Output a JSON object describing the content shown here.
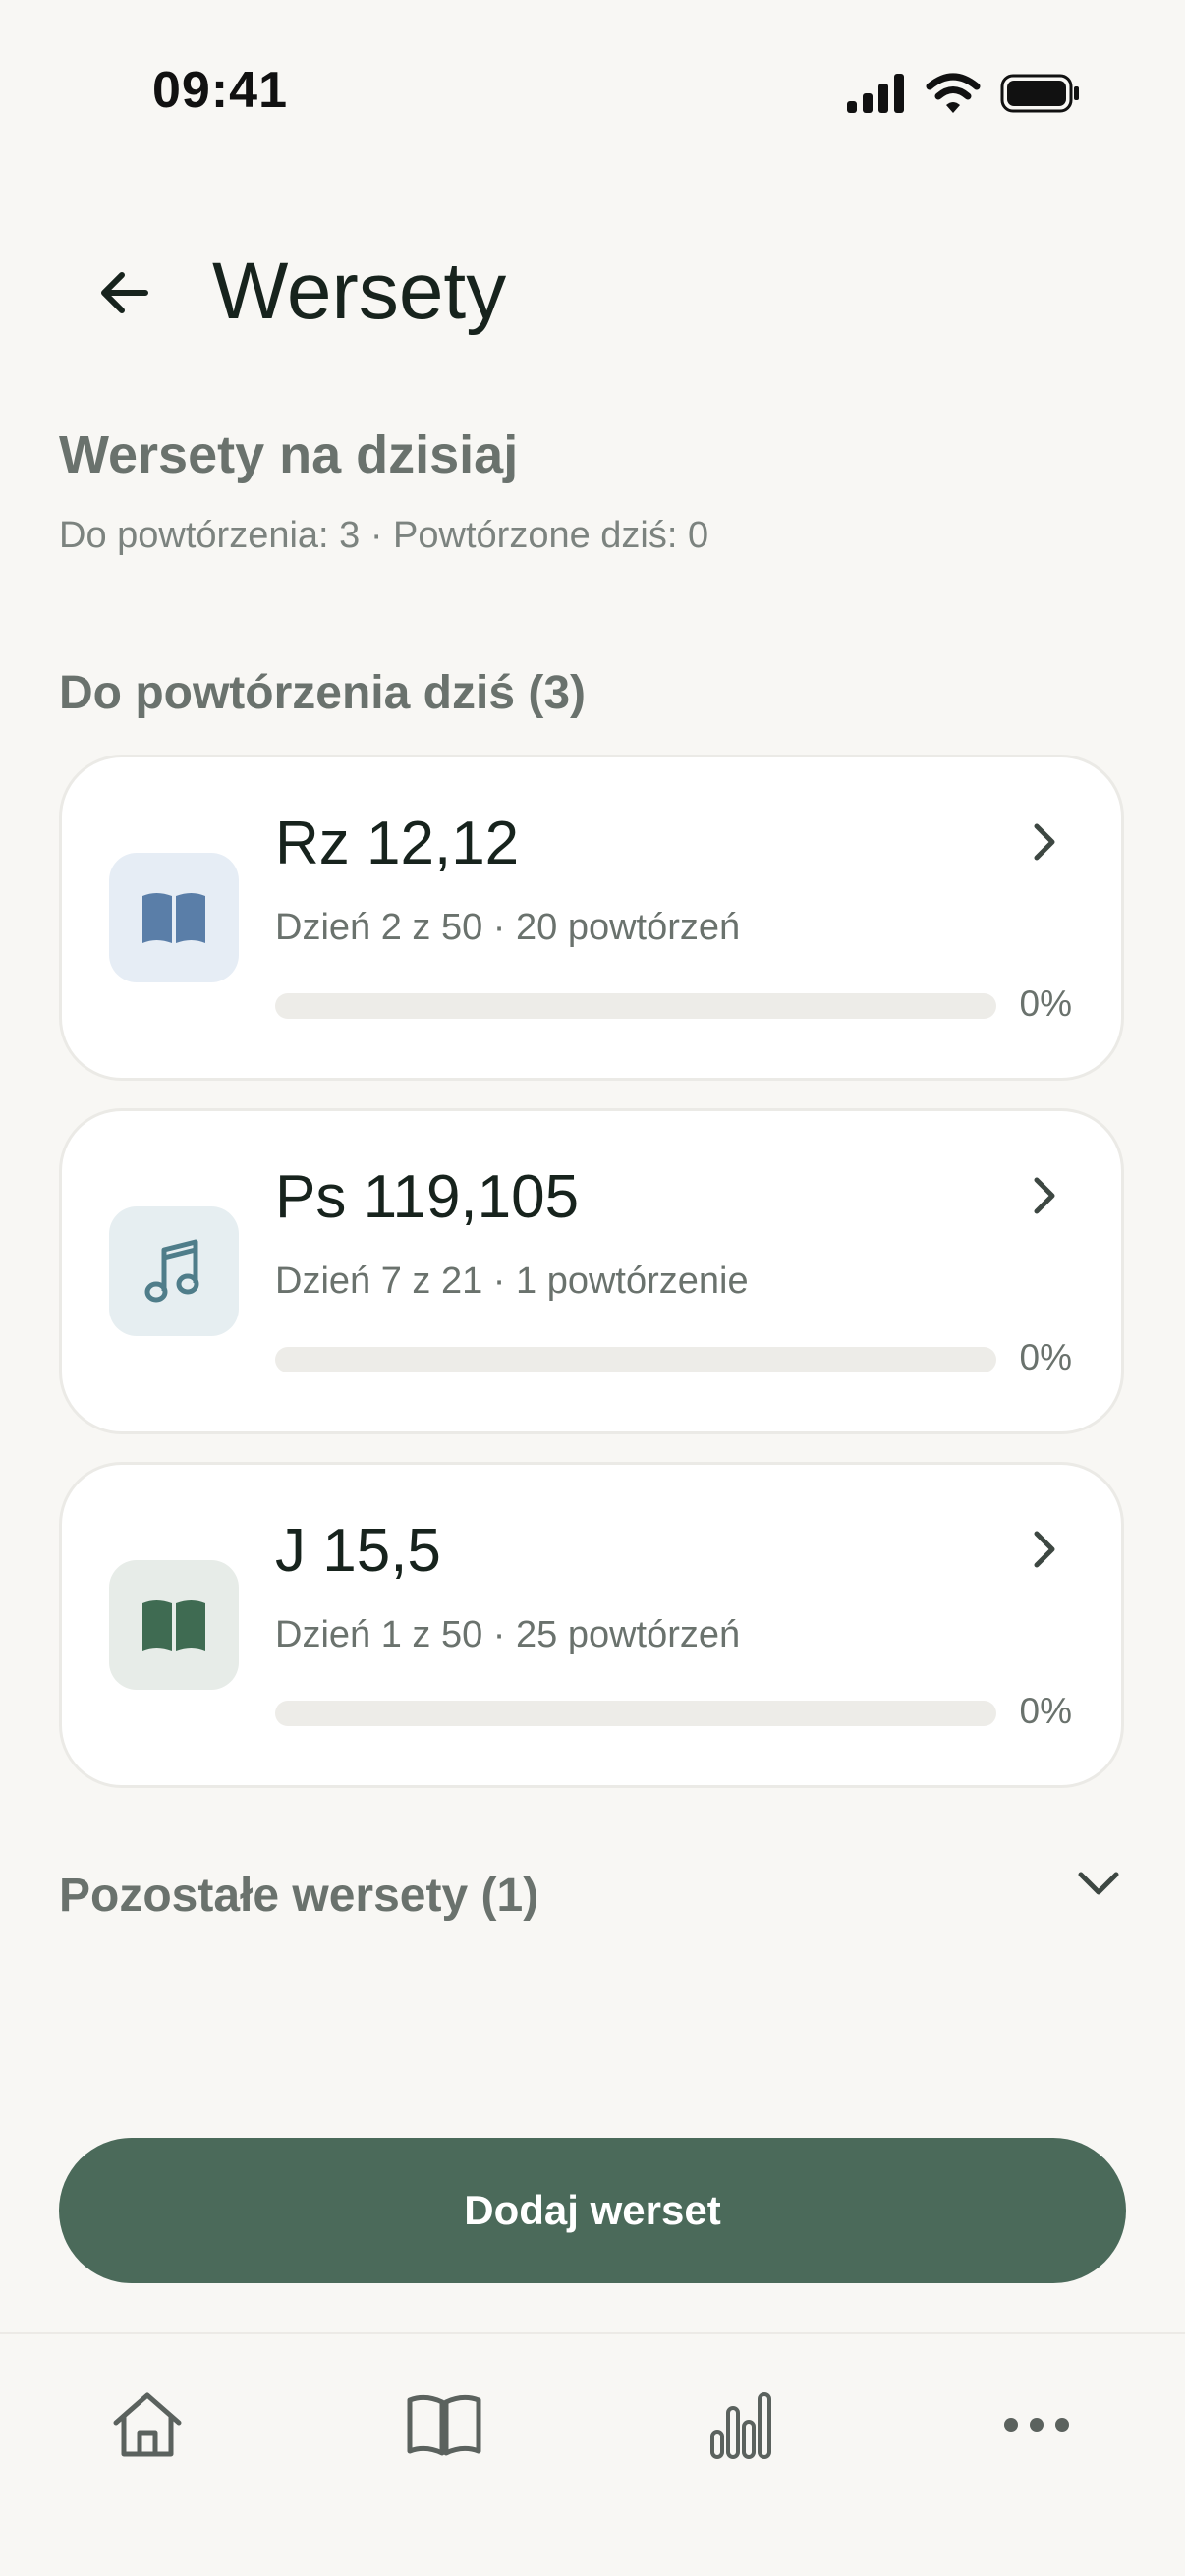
{
  "status_bar": {
    "time": "09:41"
  },
  "header": {
    "title": "Wersety"
  },
  "today": {
    "title": "Wersety na dzisiaj",
    "summary": "Do powtórzenia: 3 · Powtórzone dziś: 0"
  },
  "due_section": {
    "title": "Do powtórzenia dziś (3)"
  },
  "verses": [
    {
      "ref": "Rz 12,12",
      "meta": "Dzień 2 z 50 · 20 powtórzeń",
      "progress_label": "0%",
      "progress": 0,
      "icon": "book-open-icon",
      "icon_bg": "#e6edf5",
      "icon_color": "#5a7ea8"
    },
    {
      "ref": "Ps 119,105",
      "meta": "Dzień 7 z 21 · 1 powtórzenie",
      "progress_label": "0%",
      "progress": 0,
      "icon": "music-note-icon",
      "icon_bg": "#e6eef1",
      "icon_color": "#4f7d8a"
    },
    {
      "ref": "J 15,5",
      "meta": "Dzień 1 z 50 · 25 powtórzeń",
      "progress_label": "0%",
      "progress": 0,
      "icon": "book-open-icon",
      "icon_bg": "#e7ece8",
      "icon_color": "#3f6b52"
    }
  ],
  "others_section": {
    "title": "Pozostałe wersety (1)"
  },
  "actions": {
    "add_label": "Dodaj werset"
  },
  "colors": {
    "accent": "#4b6a5a",
    "background": "#f8f7f4"
  },
  "nav": [
    {
      "icon": "home-icon"
    },
    {
      "icon": "book-icon"
    },
    {
      "icon": "stats-icon"
    },
    {
      "icon": "more-icon"
    }
  ]
}
